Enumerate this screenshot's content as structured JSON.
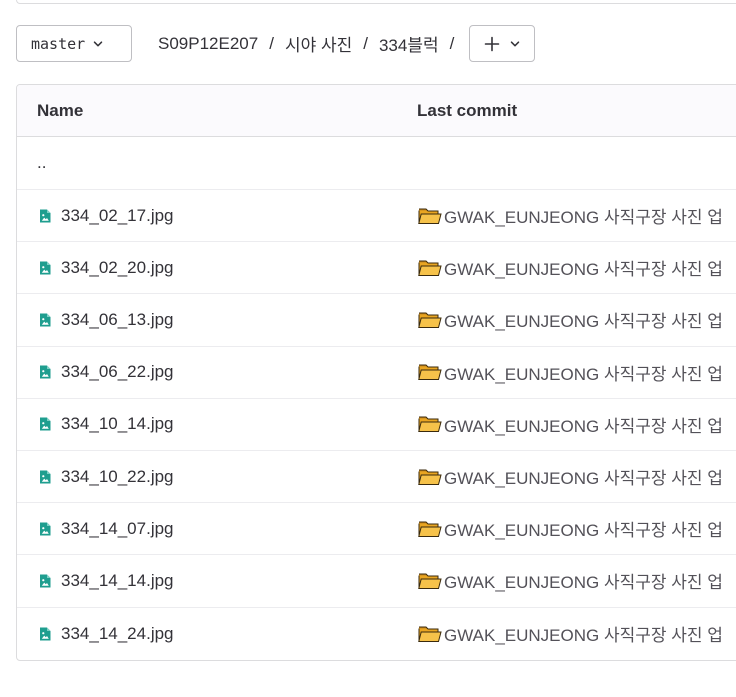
{
  "branch": {
    "label": "master"
  },
  "breadcrumb": {
    "items": [
      "S09P12E207",
      "시야 사진",
      "334블럭"
    ],
    "separator": "/"
  },
  "add_button": {
    "icon": "plus-icon"
  },
  "table": {
    "headers": {
      "name": "Name",
      "last_commit": "Last commit"
    },
    "parent_dir": "..",
    "rows": [
      {
        "name": "334_02_17.jpg",
        "commit": "GWAK_EUNJEONG 사직구장 사진 업"
      },
      {
        "name": "334_02_20.jpg",
        "commit": "GWAK_EUNJEONG 사직구장 사진 업"
      },
      {
        "name": "334_06_13.jpg",
        "commit": "GWAK_EUNJEONG 사직구장 사진 업"
      },
      {
        "name": "334_06_22.jpg",
        "commit": "GWAK_EUNJEONG 사직구장 사진 업"
      },
      {
        "name": "334_10_14.jpg",
        "commit": "GWAK_EUNJEONG 사직구장 사진 업"
      },
      {
        "name": "334_10_22.jpg",
        "commit": "GWAK_EUNJEONG 사직구장 사진 업"
      },
      {
        "name": "334_14_07.jpg",
        "commit": "GWAK_EUNJEONG 사직구장 사진 업"
      },
      {
        "name": "334_14_14.jpg",
        "commit": "GWAK_EUNJEONG 사직구장 사진 업"
      },
      {
        "name": "334_14_24.jpg",
        "commit": "GWAK_EUNJEONG 사직구장 사진 업"
      }
    ]
  },
  "colors": {
    "file_icon": "#1f9e8f",
    "folder_icon": "#f4b63d",
    "border": "#dcdcde"
  }
}
